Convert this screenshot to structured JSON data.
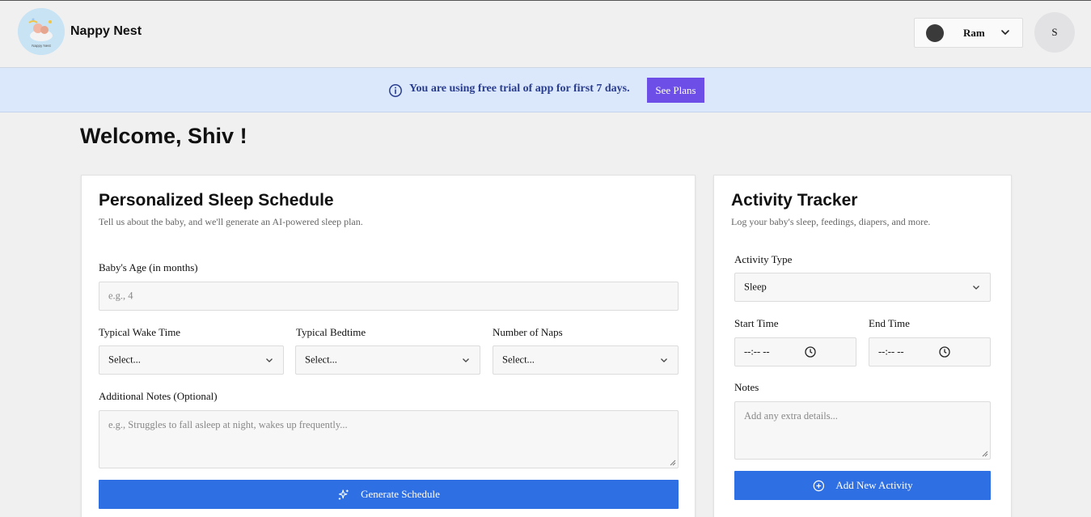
{
  "header": {
    "brand": "Nappy Nest",
    "logo_text": "Nappy Nest",
    "child_name": "Ram",
    "avatar_initial": "S"
  },
  "banner": {
    "message": "You are using free trial of app for first 7 days.",
    "cta": "See Plans"
  },
  "welcome": "Welcome, Shiv !",
  "sleep_card": {
    "title": "Personalized Sleep Schedule",
    "subtitle": "Tell us about the baby, and we'll generate an AI-powered sleep plan.",
    "age_label": "Baby's Age (in months)",
    "age_placeholder": "e.g., 4",
    "wake_label": "Typical Wake Time",
    "wake_value": "Select...",
    "bed_label": "Typical Bedtime",
    "bed_value": "Select...",
    "naps_label": "Number of Naps",
    "naps_value": "Select...",
    "notes_label": "Additional Notes (Optional)",
    "notes_placeholder": "e.g., Struggles to fall asleep at night, wakes up frequently...",
    "generate_label": "Generate Schedule"
  },
  "activity_card": {
    "title": "Activity Tracker",
    "subtitle": "Log your baby's sleep, feedings, diapers, and more.",
    "type_label": "Activity Type",
    "type_value": "Sleep",
    "start_label": "Start Time",
    "start_value": "--:-- --",
    "end_label": "End Time",
    "end_value": "--:-- --",
    "notes_label": "Notes",
    "notes_placeholder": "Add any extra details...",
    "add_label": "Add New Activity"
  },
  "colors": {
    "accent_blue": "#2f6fe4",
    "banner_bg": "#dbe7fb",
    "banner_text": "#2a3e8f",
    "plans_button": "#6d4ee6"
  },
  "icons": {
    "info": "info-icon",
    "chevron": "chevron-down-icon",
    "clock": "clock-icon",
    "sparkle": "sparkle-icon",
    "plus_circle": "plus-circle-icon"
  }
}
